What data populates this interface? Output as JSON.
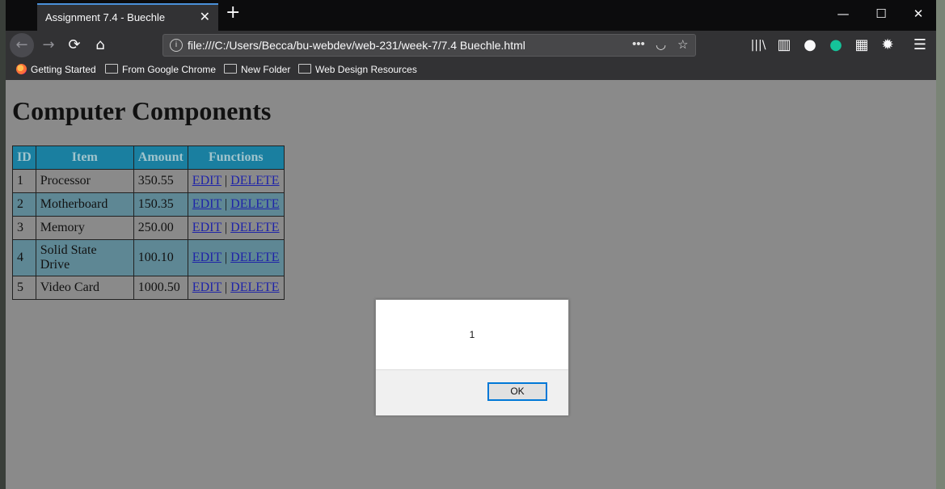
{
  "browser": {
    "tab_title": "Assignment 7.4 - Buechle",
    "tab_close": "✕",
    "new_tab": "+",
    "url": "file:///C:/Users/Becca/bu-webdev/web-231/week-7/7.4 Buechle.html",
    "window_controls": {
      "minimize": "—",
      "maximize": "☐",
      "close": "✕"
    },
    "toolbar_icons": [
      "back-icon",
      "forward-icon",
      "reload-icon",
      "home-icon",
      "library-icon",
      "sidebar-icon",
      "account-icon",
      "grammarly-icon",
      "extension-icon",
      "settings-icon",
      "menu-icon"
    ]
  },
  "bookmarks": [
    {
      "label": "Getting Started",
      "icon": "firefox-icon"
    },
    {
      "label": "From Google Chrome",
      "icon": "folder-icon"
    },
    {
      "label": "New Folder",
      "icon": "folder-icon"
    },
    {
      "label": "Web Design Resources",
      "icon": "folder-icon"
    }
  ],
  "page": {
    "heading": "Computer Components",
    "table": {
      "headers": [
        "ID",
        "Item",
        "Amount",
        "Functions"
      ],
      "rows": [
        {
          "id": "1",
          "item": "Processor",
          "amount": "350.55"
        },
        {
          "id": "2",
          "item": "Motherboard",
          "amount": "150.35"
        },
        {
          "id": "3",
          "item": "Memory",
          "amount": "250.00"
        },
        {
          "id": "4",
          "item": "Solid State Drive",
          "amount": "100.10"
        },
        {
          "id": "5",
          "item": "Video Card",
          "amount": "1000.50"
        }
      ],
      "edit_label": "EDIT",
      "separator": "|",
      "delete_label": "DELETE"
    }
  },
  "dialog": {
    "message": "1",
    "ok_label": "OK"
  },
  "colors": {
    "table_header": "#1a7fa0",
    "alt_row": "#5e8794",
    "page_background": "#8a8a8a",
    "dialog_focus": "#0078d7"
  }
}
